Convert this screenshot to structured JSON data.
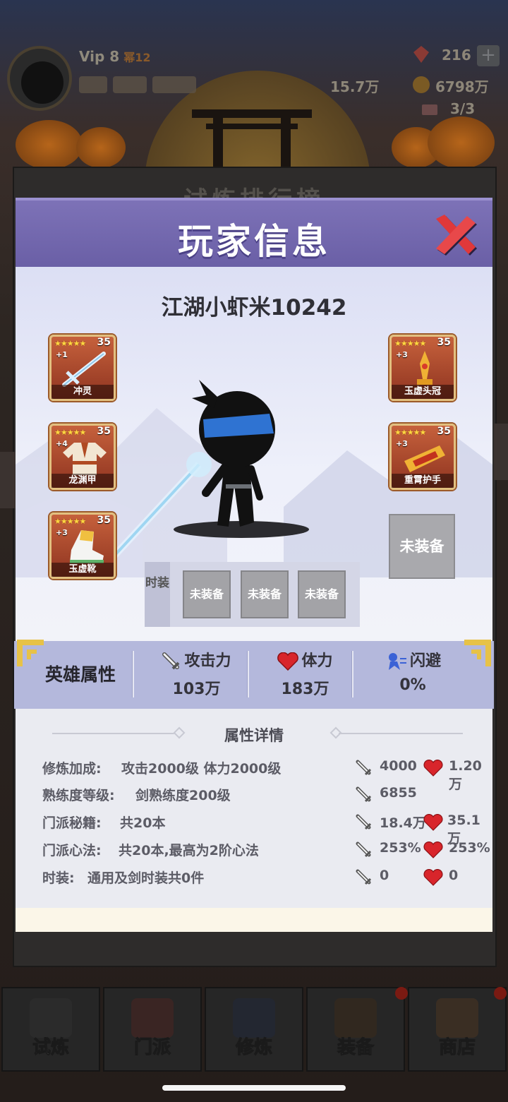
{
  "background": {
    "vip_label": "Vip 8",
    "vip_sub": "幂12",
    "gems": "216",
    "gold": "6798万",
    "power": "15.7万",
    "tickets": "3/3",
    "panel_title": "试炼排行榜"
  },
  "modal": {
    "title": "玩家信息",
    "player_name": "江湖小虾米10242",
    "equipment_left": [
      {
        "name": "冲灵",
        "stars": "★★★★★",
        "level": "35",
        "plus": "+1",
        "icon": "sword-icon"
      },
      {
        "name": "龙渊甲",
        "stars": "★★★★★",
        "level": "35",
        "plus": "+4",
        "icon": "armor-icon"
      },
      {
        "name": "玉虚靴",
        "stars": "★★★★★",
        "level": "35",
        "plus": "+3",
        "icon": "boots-icon"
      }
    ],
    "equipment_right": [
      {
        "name": "玉虚头冠",
        "stars": "★★★★★",
        "level": "35",
        "plus": "+3",
        "icon": "crown-icon"
      },
      {
        "name": "重霄护手",
        "stars": "★★★★★",
        "level": "35",
        "plus": "+3",
        "icon": "gauntlet-icon"
      }
    ],
    "empty_slot_label": "未装备",
    "fashion": {
      "label": "时装",
      "slots": [
        "未装备",
        "未装备",
        "未装备"
      ]
    },
    "hero_stats": {
      "heading": "英雄属性",
      "attack": {
        "label": "攻击力",
        "value": "103万"
      },
      "hp": {
        "label": "体力",
        "value": "183万"
      },
      "dodge": {
        "label": "闪避",
        "value": "0%"
      }
    },
    "details": {
      "title": "属性详情",
      "rows": [
        {
          "key": "修炼加成:",
          "value": "攻击2000级 体力2000级",
          "atk": "4000",
          "hp": "1.20万"
        },
        {
          "key": "熟练度等级:",
          "value": "剑熟练度200级",
          "atk": "6855",
          "hp": ""
        },
        {
          "key": "门派秘籍:",
          "value": "共20本",
          "atk": "18.4万",
          "hp": "35.1万"
        },
        {
          "key": "门派心法:",
          "value": "共20本,最高为2阶心法",
          "atk": "253%",
          "hp": "253%"
        },
        {
          "key": "时装:",
          "value": "通用及剑时装共0件",
          "atk": "0",
          "hp": "0"
        }
      ]
    }
  },
  "bottom_nav": [
    {
      "label": "试炼"
    },
    {
      "label": "门派"
    },
    {
      "label": "修炼"
    },
    {
      "label": "装备"
    },
    {
      "label": "商店"
    }
  ],
  "colors": {
    "header": "#7d72b7",
    "stats_bar": "#b4b8dc",
    "equip_frame": "#c6613c",
    "empty_slot": "#a9a9ad",
    "heart": "#d8252b"
  }
}
